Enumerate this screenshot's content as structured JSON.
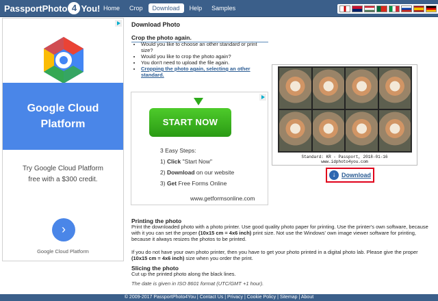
{
  "brand": {
    "name_left": "PassportPhoto",
    "name_mid": "4",
    "name_right": "You!"
  },
  "nav": [
    {
      "label": "Home"
    },
    {
      "label": "Crop"
    },
    {
      "label": "Download",
      "active": true
    },
    {
      "label": "Help"
    },
    {
      "label": "Samples"
    }
  ],
  "flags": [
    "flag-gb",
    "flag-de",
    "flag-hu",
    "flag-pt",
    "flag-it",
    "flag-ru",
    "flag-es",
    "flag-nl",
    "flag-de2"
  ],
  "ad_left": {
    "title_line1": "Google Cloud",
    "title_line2": "Platform",
    "text_line1": "Try Google Cloud Platform",
    "text_line2": "free with a $300 credit.",
    "footer": "Google Cloud Platform",
    "accent": "#4a86e8"
  },
  "main": {
    "heading": "Download Photo",
    "crop_heading": "Crop the photo again.",
    "crop_items": [
      "Would you like to choose an other standard or print size?",
      "Would you like to crop the photo again?",
      "You don't need to upload the file again."
    ],
    "crop_link": "Cropping the photo again, selecting an other standard."
  },
  "ad_mid": {
    "button": "START NOW",
    "steps_title": "3 Easy Steps:",
    "step1_num": "1)",
    "step1_bold": "Click",
    "step1_rest": " \"Start Now\"",
    "step2_num": "2)",
    "step2_bold": "Download",
    "step2_rest": " on our website",
    "step3_num": "3)",
    "step3_bold": "Get",
    "step3_rest": " Free Forms Online",
    "url": "www.getformsonline.com"
  },
  "photo": {
    "caption_line1": "Standard: KR - Passport, 2018-01-16",
    "caption_line2": "www.idphoto4you.com",
    "download_label": "Download"
  },
  "printing": {
    "heading": "Printing the photo",
    "p1_a": "Print the downloaded photo with a photo printer. Use good quality photo paper for printing. Use the printer's own software, because with it you can set the proper ",
    "p1_b": "(10x15 cm = 4x6 inch)",
    "p1_c": " print size. Not use the Windows' own image viewer software for printing, because it always resizes the photos to be printed.",
    "p2_a": "If you do not have your own photo printer, then you have to get your photo printed in a digital photo lab. Please give the proper ",
    "p2_b": "(10x15 cm = 4x6 inch)",
    "p2_c": " size when you order the print."
  },
  "slicing": {
    "heading": "Slicing the photo",
    "text": "Cut up the printed photo along the black lines.",
    "date_note": "The date is given in ISO 8601 format (UTC/GMT +1 hour)."
  },
  "footer": {
    "copyright": "© 2009-2017 PassportPhoto4You",
    "links": [
      "Contact Us",
      "Privacy",
      "Cookie Policy",
      "Sitemap",
      "About"
    ]
  }
}
